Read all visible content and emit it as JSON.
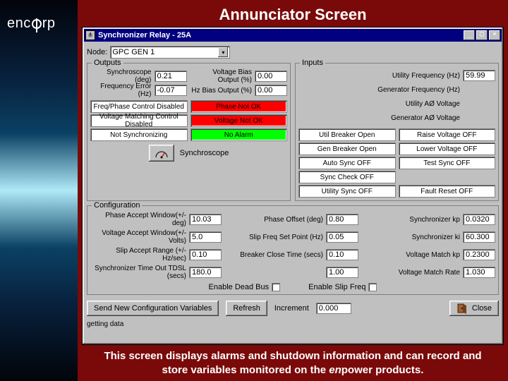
{
  "brand": "encorp",
  "slide_title": "Annunciator Screen",
  "caption_a": "This screen displays alarms and shutdown information and can record and store variables monitored on the ",
  "caption_em": "en",
  "caption_b": "power products.",
  "window_title": "Synchronizer Relay - 25A",
  "node_label": "Node:",
  "node_value": "GPC GEN 1",
  "outputs_legend": "Outputs",
  "inputs_legend": "Inputs",
  "config_legend": "Configuration",
  "outputs": {
    "synchroscope_label": "Synchroscope (deg)",
    "synchroscope_value": "0.21",
    "freq_error_label": "Frequency Error (Hz)",
    "freq_error_value": "-0.07",
    "voltage_bias_label": "Voltage Bias Output (%)",
    "voltage_bias_value": "0.00",
    "hz_bias_label": "Hz Bias Output (%)",
    "hz_bias_value": "0.00"
  },
  "annunciators_left": [
    "Freq/Phase Control Disabled",
    "Voltage Matching Control Disabled",
    "Not Synchronizing"
  ],
  "annunciators_mid": [
    {
      "text": "Phase Not OK",
      "cls": "red"
    },
    {
      "text": "Voltage Not OK",
      "cls": "red"
    },
    {
      "text": "No Alarm",
      "cls": "green"
    }
  ],
  "synchroscope_caption": "Synchroscope",
  "inputs": {
    "util_freq_label": "Utility Frequency (Hz)",
    "util_freq_value": "59.99",
    "gen_freq_label": "Generator Frequency (Hz)",
    "util_av_label": "Utility AØ Voltage",
    "gen_av_label": "Generator AØ Voltage"
  },
  "inputs_ann_col1": [
    "Util Breaker Open",
    "Gen Breaker Open",
    "Auto Sync OFF",
    "Sync Check OFF",
    "Utility Sync OFF"
  ],
  "inputs_ann_col2": [
    "Raise Voltage OFF",
    "Lower Voltage OFF",
    "Test Sync OFF",
    "",
    "Fault Reset OFF"
  ],
  "config": {
    "phase_accept_label": "Phase Accept Window(+/- deg)",
    "phase_accept_value": "10.03",
    "voltage_accept_label": "Voltage Accept Window(+/- Volts)",
    "voltage_accept_value": "5.0",
    "slip_accept_label": "Slip Accept Range (+/- Hz/sec)",
    "slip_accept_value": "0.10",
    "sync_timeout_label": "Synchronizer Time Out TDSL (secs)",
    "sync_timeout_value": "180.0",
    "phase_offset_label": "Phase Offset (deg)",
    "phase_offset_value": "0.80",
    "slip_setpoint_label": "Slip Freq Set Point (Hz)",
    "slip_setpoint_value": "0.05",
    "breaker_close_label": "Breaker Close Time (secs)",
    "breaker_close_value": "0.10",
    "blank_label": "",
    "blank_value": "1.00",
    "sync_kp_label": "Synchronizer kp",
    "sync_kp_value": "0.0320",
    "sync_ki_label": "Synchronizer ki",
    "sync_ki_value": "60.300",
    "vmatch_kp_label": "Voltage Match kp",
    "vmatch_kp_value": "0.2300",
    "vmatch_rate_label": "Voltage Match Rate",
    "vmatch_rate_value": "1.030"
  },
  "enable_deadbus_label": "Enable Dead Bus",
  "enable_slipfreq_label": "Enable Slip Freq",
  "send_button": "Send New Configuration Variables",
  "refresh_button": "Refresh",
  "increment_label": "Increment",
  "increment_value": "0.000",
  "close_button": "Close",
  "status_text": "getting data"
}
